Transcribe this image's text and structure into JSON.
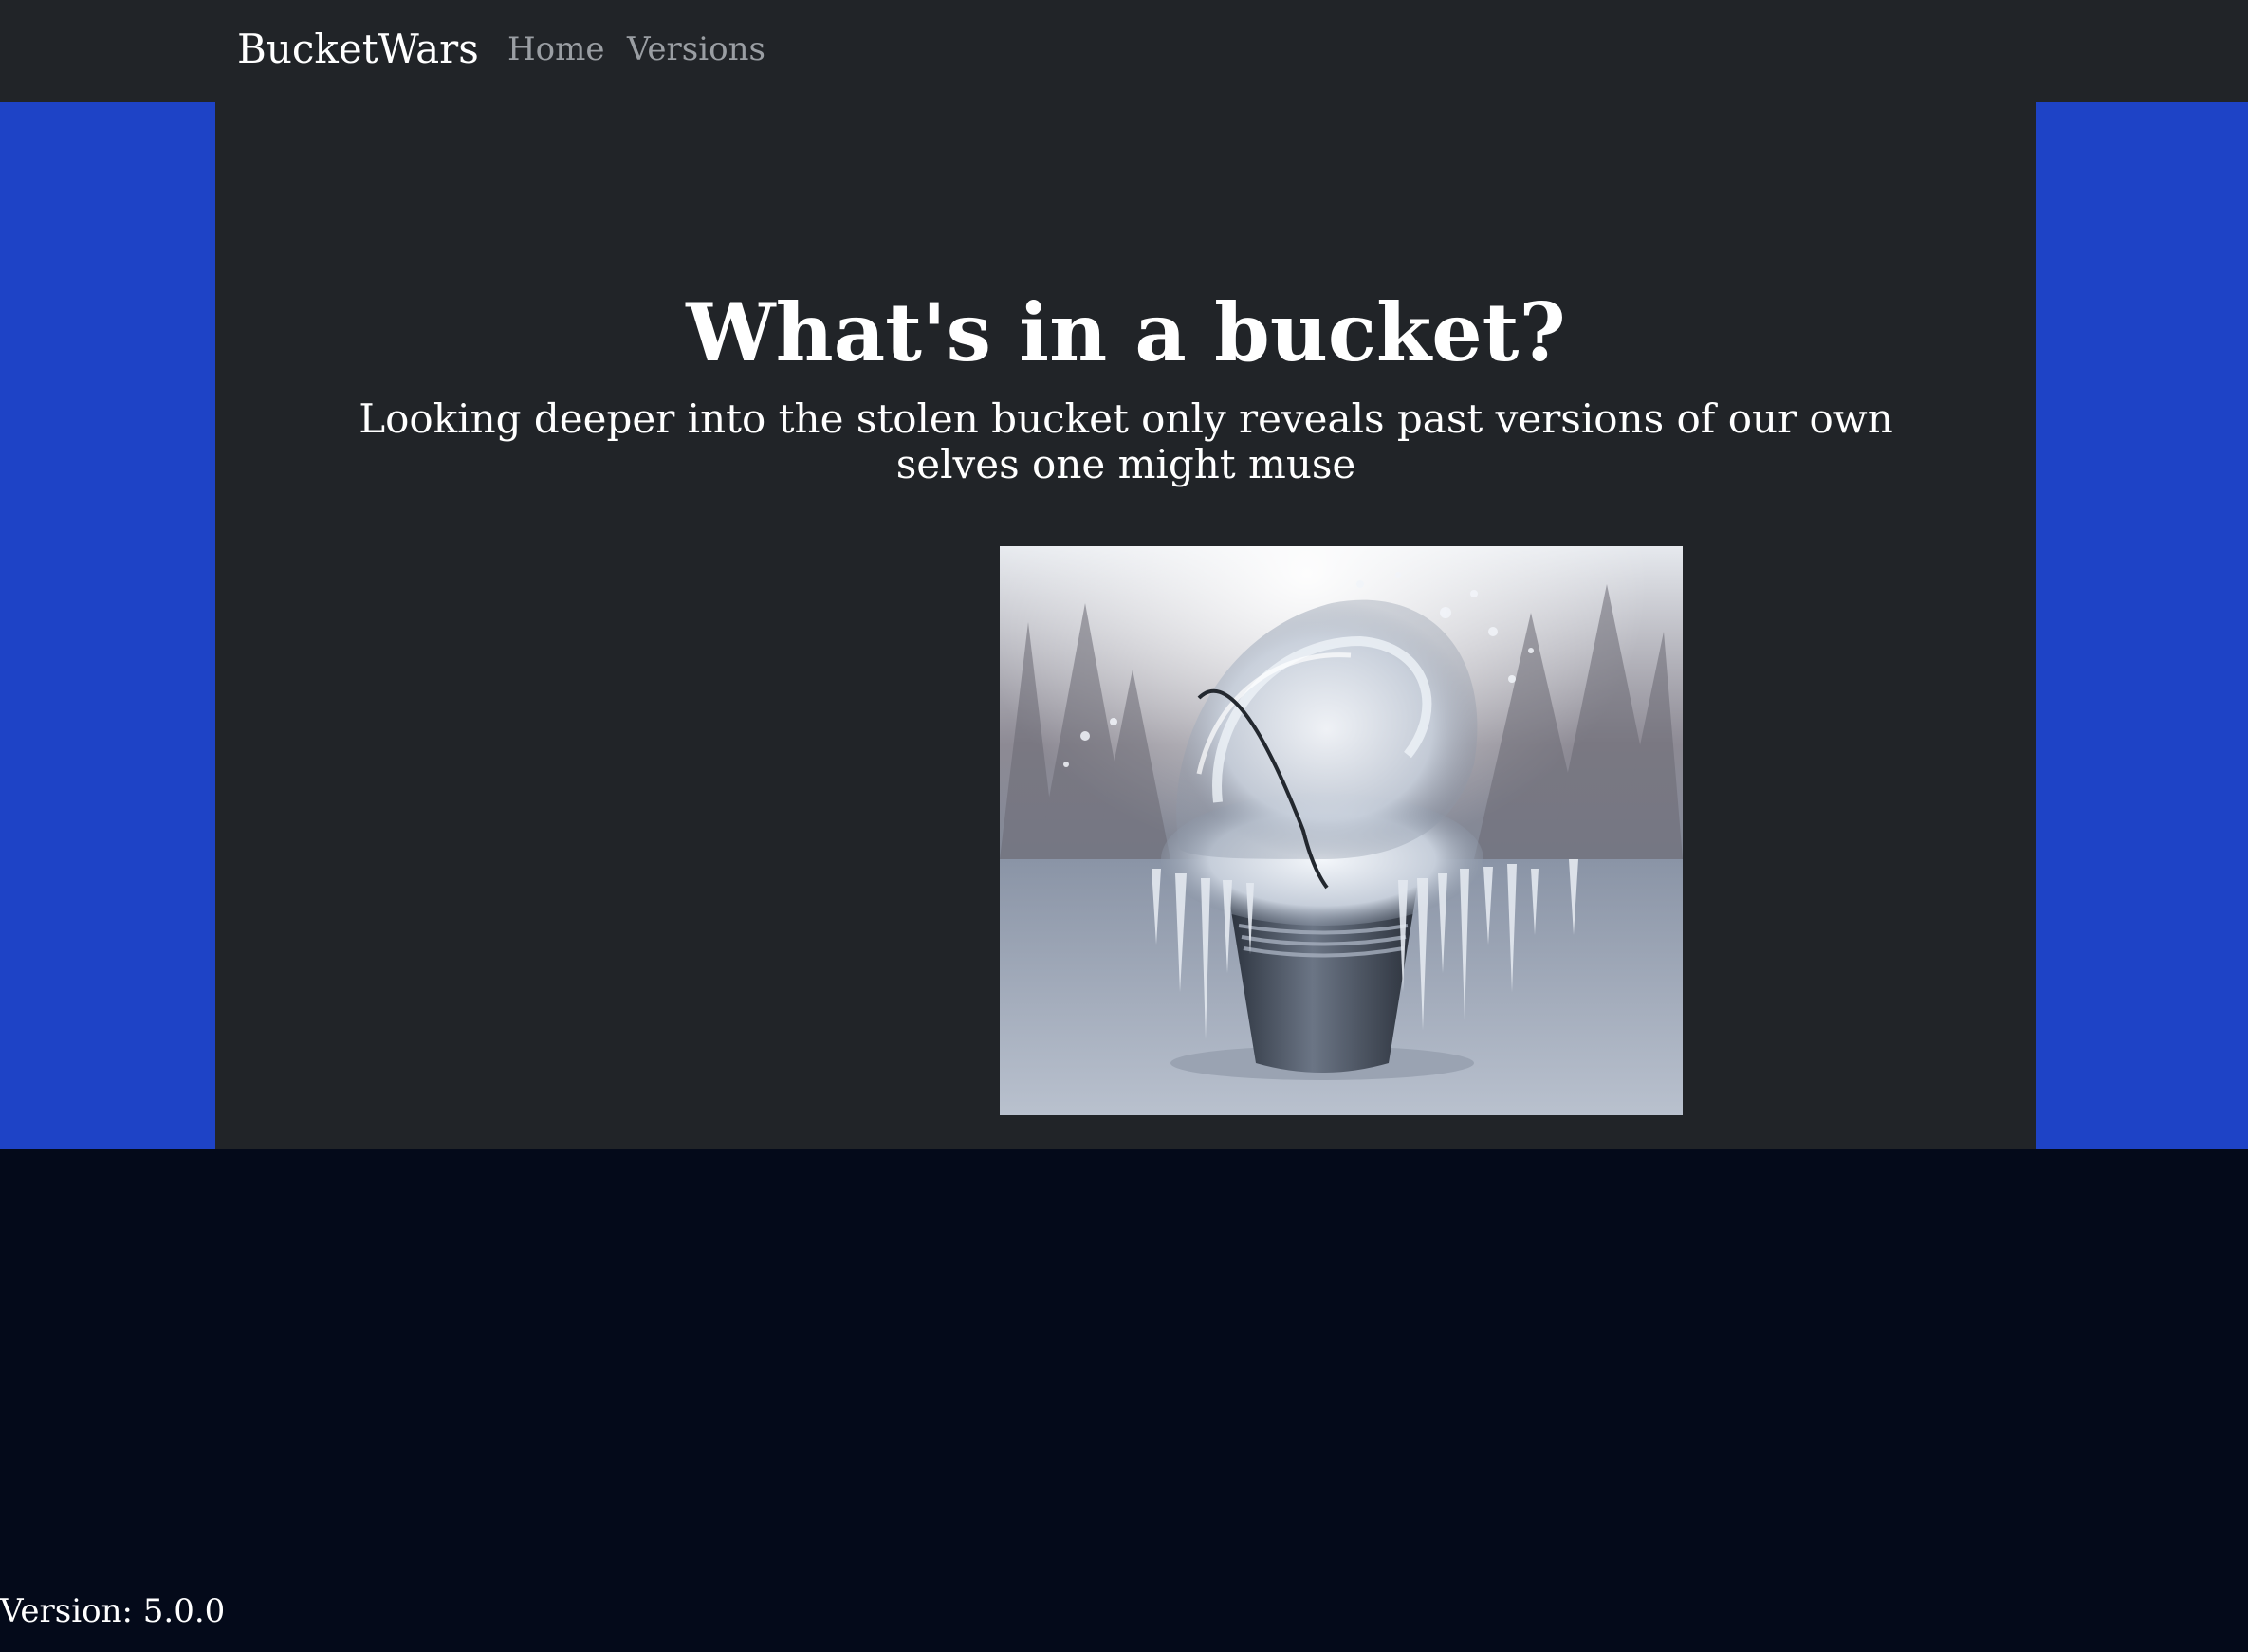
{
  "navbar": {
    "brand": "BucketWars",
    "links": [
      {
        "label": "Home"
      },
      {
        "label": "Versions"
      }
    ]
  },
  "hero": {
    "title": "What's in a bucket?",
    "subtitle": "Looking deeper into the stolen bucket only reveals past versions of our own selves one might muse",
    "image": {
      "alt": "Frozen bucket with icicles and splashing ice"
    }
  },
  "footer": {
    "version_text": "Version: 5.0.0"
  },
  "colors": {
    "navbar_bg": "#212428",
    "accent_band": "#1e43c6",
    "page_bg": "#040a1a",
    "nav_link": "#9a9ea3",
    "text": "#ffffff"
  }
}
